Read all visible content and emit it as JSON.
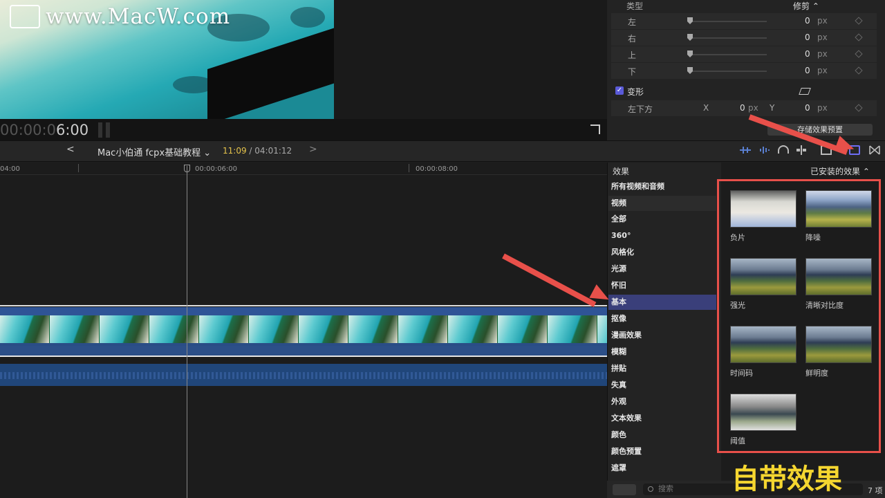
{
  "watermark": "www.MacW.com",
  "viewer": {
    "timecode_dim": "00:00:0",
    "timecode_bright": "6:00"
  },
  "inspector": {
    "type_label": "类型",
    "type_value": "修剪 ⌃",
    "rows": [
      {
        "label": "左",
        "value": "0",
        "unit": "px"
      },
      {
        "label": "右",
        "value": "0",
        "unit": "px"
      },
      {
        "label": "上",
        "value": "0",
        "unit": "px"
      },
      {
        "label": "下",
        "value": "0",
        "unit": "px"
      }
    ],
    "transform_label": "变形",
    "bottom_left": {
      "label": "左下方",
      "x_label": "X",
      "x_value": "0",
      "x_unit": "px",
      "y_label": "Y",
      "y_value": "0",
      "y_unit": "px"
    },
    "save_preset": "存储效果预置"
  },
  "toolbar": {
    "back": "<",
    "forward": ">",
    "project_title": "Mac小伯通 fcpx基础教程 ⌄",
    "current_time": "11:09",
    "total_time": " / 04:01:12"
  },
  "ruler": {
    "labels": [
      "04:00",
      "00:00:06:00",
      "00:00:08:00"
    ]
  },
  "effects": {
    "header": "效果",
    "installed": "已安装的效果 ⌃",
    "categories": [
      "所有视频和音频",
      "视频",
      "全部",
      "360°",
      "风格化",
      "光源",
      "怀旧",
      "基本",
      "抠像",
      "漫画效果",
      "模糊",
      "拼贴",
      "失真",
      "外观",
      "文本效果",
      "颜色",
      "颜色预置",
      "遮罩"
    ],
    "selected": "基本",
    "items": [
      "负片",
      "降噪",
      "强光",
      "清晰对比度",
      "时间码",
      "鲜明度",
      "阈值"
    ],
    "search_placeholder": "搜索",
    "count": "7 项"
  },
  "caption": "自带效果",
  "colors": {
    "accent": "#6e6ef5",
    "annotation": "#e8504a",
    "caption": "#f5d630",
    "timecode": "#e6c44c"
  }
}
